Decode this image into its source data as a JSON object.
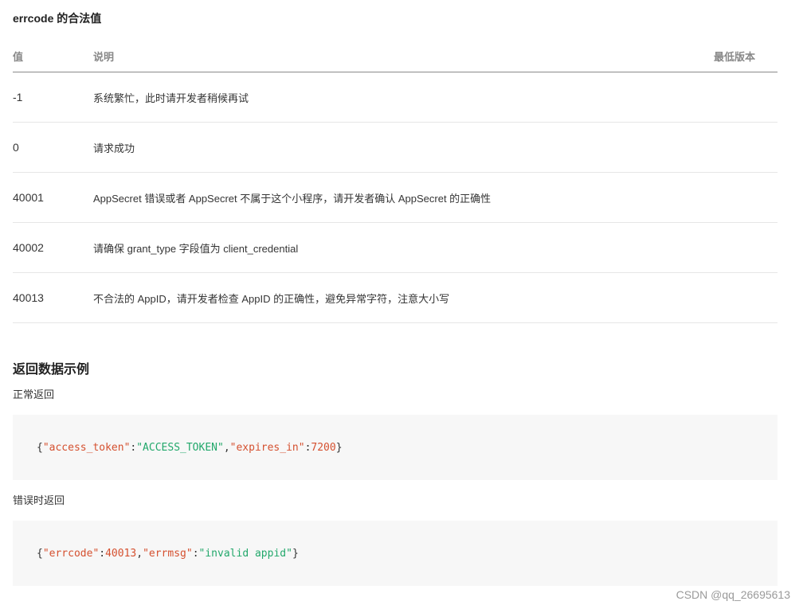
{
  "errcode_section": {
    "title": "errcode 的合法值",
    "headers": {
      "value": "值",
      "desc": "说明",
      "version": "最低版本"
    },
    "rows": [
      {
        "value": "-1",
        "desc": "系统繁忙，此时请开发者稍候再试",
        "version": ""
      },
      {
        "value": "0",
        "desc": "请求成功",
        "version": ""
      },
      {
        "value": "40001",
        "desc": "AppSecret 错误或者 AppSecret 不属于这个小程序，请开发者确认 AppSecret 的正确性",
        "version": ""
      },
      {
        "value": "40002",
        "desc": "请确保 grant_type 字段值为 client_credential",
        "version": ""
      },
      {
        "value": "40013",
        "desc": "不合法的 AppID，请开发者检查 AppID 的正确性，避免异常字符，注意大小写",
        "version": ""
      }
    ]
  },
  "example_section": {
    "title": "返回数据示例",
    "normal_label": "正常返回",
    "normal_code": {
      "open": "{",
      "k1": "\"access_token\"",
      "colon1": ":",
      "v1": "\"ACCESS_TOKEN\"",
      "comma": ",",
      "k2": "\"expires_in\"",
      "colon2": ":",
      "v2": "7200",
      "close": "}"
    },
    "error_label": "错误时返回",
    "error_code": {
      "open": "{",
      "k1": "\"errcode\"",
      "colon1": ":",
      "v1": "40013",
      "comma": ",",
      "k2": "\"errmsg\"",
      "colon2": ":",
      "v2": "\"invalid appid\"",
      "close": "}"
    }
  },
  "watermark": "CSDN @qq_26695613",
  "colors": {
    "json_key": "#d5502f",
    "json_string": "#22a86b",
    "code_background": "#f7f7f7"
  }
}
